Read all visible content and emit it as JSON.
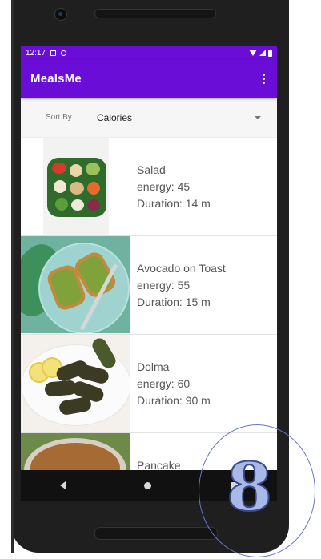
{
  "status_bar": {
    "time": "12:17"
  },
  "app_bar": {
    "title": "MealsMe",
    "menu_icon": "more-vert-icon"
  },
  "sort": {
    "label": "Sort By",
    "selected": "Calories"
  },
  "meals": [
    {
      "name": "Salad",
      "energy": "energy: 45",
      "duration": "Duration: 14 m",
      "image": "salad-image"
    },
    {
      "name": "Avocado on Toast",
      "energy": "energy: 55",
      "duration": "Duration: 15 m",
      "image": "avocado-toast-image"
    },
    {
      "name": "Dolma",
      "energy": "energy: 60",
      "duration": "Duration: 90 m",
      "image": "dolma-image"
    },
    {
      "name": "Pancake",
      "energy": "",
      "duration": "",
      "image": "pancake-image"
    }
  ],
  "overlay": {
    "number": "8"
  },
  "colors": {
    "primary": "#6a0dd6",
    "text": "#555555",
    "background": "#ffffff"
  }
}
